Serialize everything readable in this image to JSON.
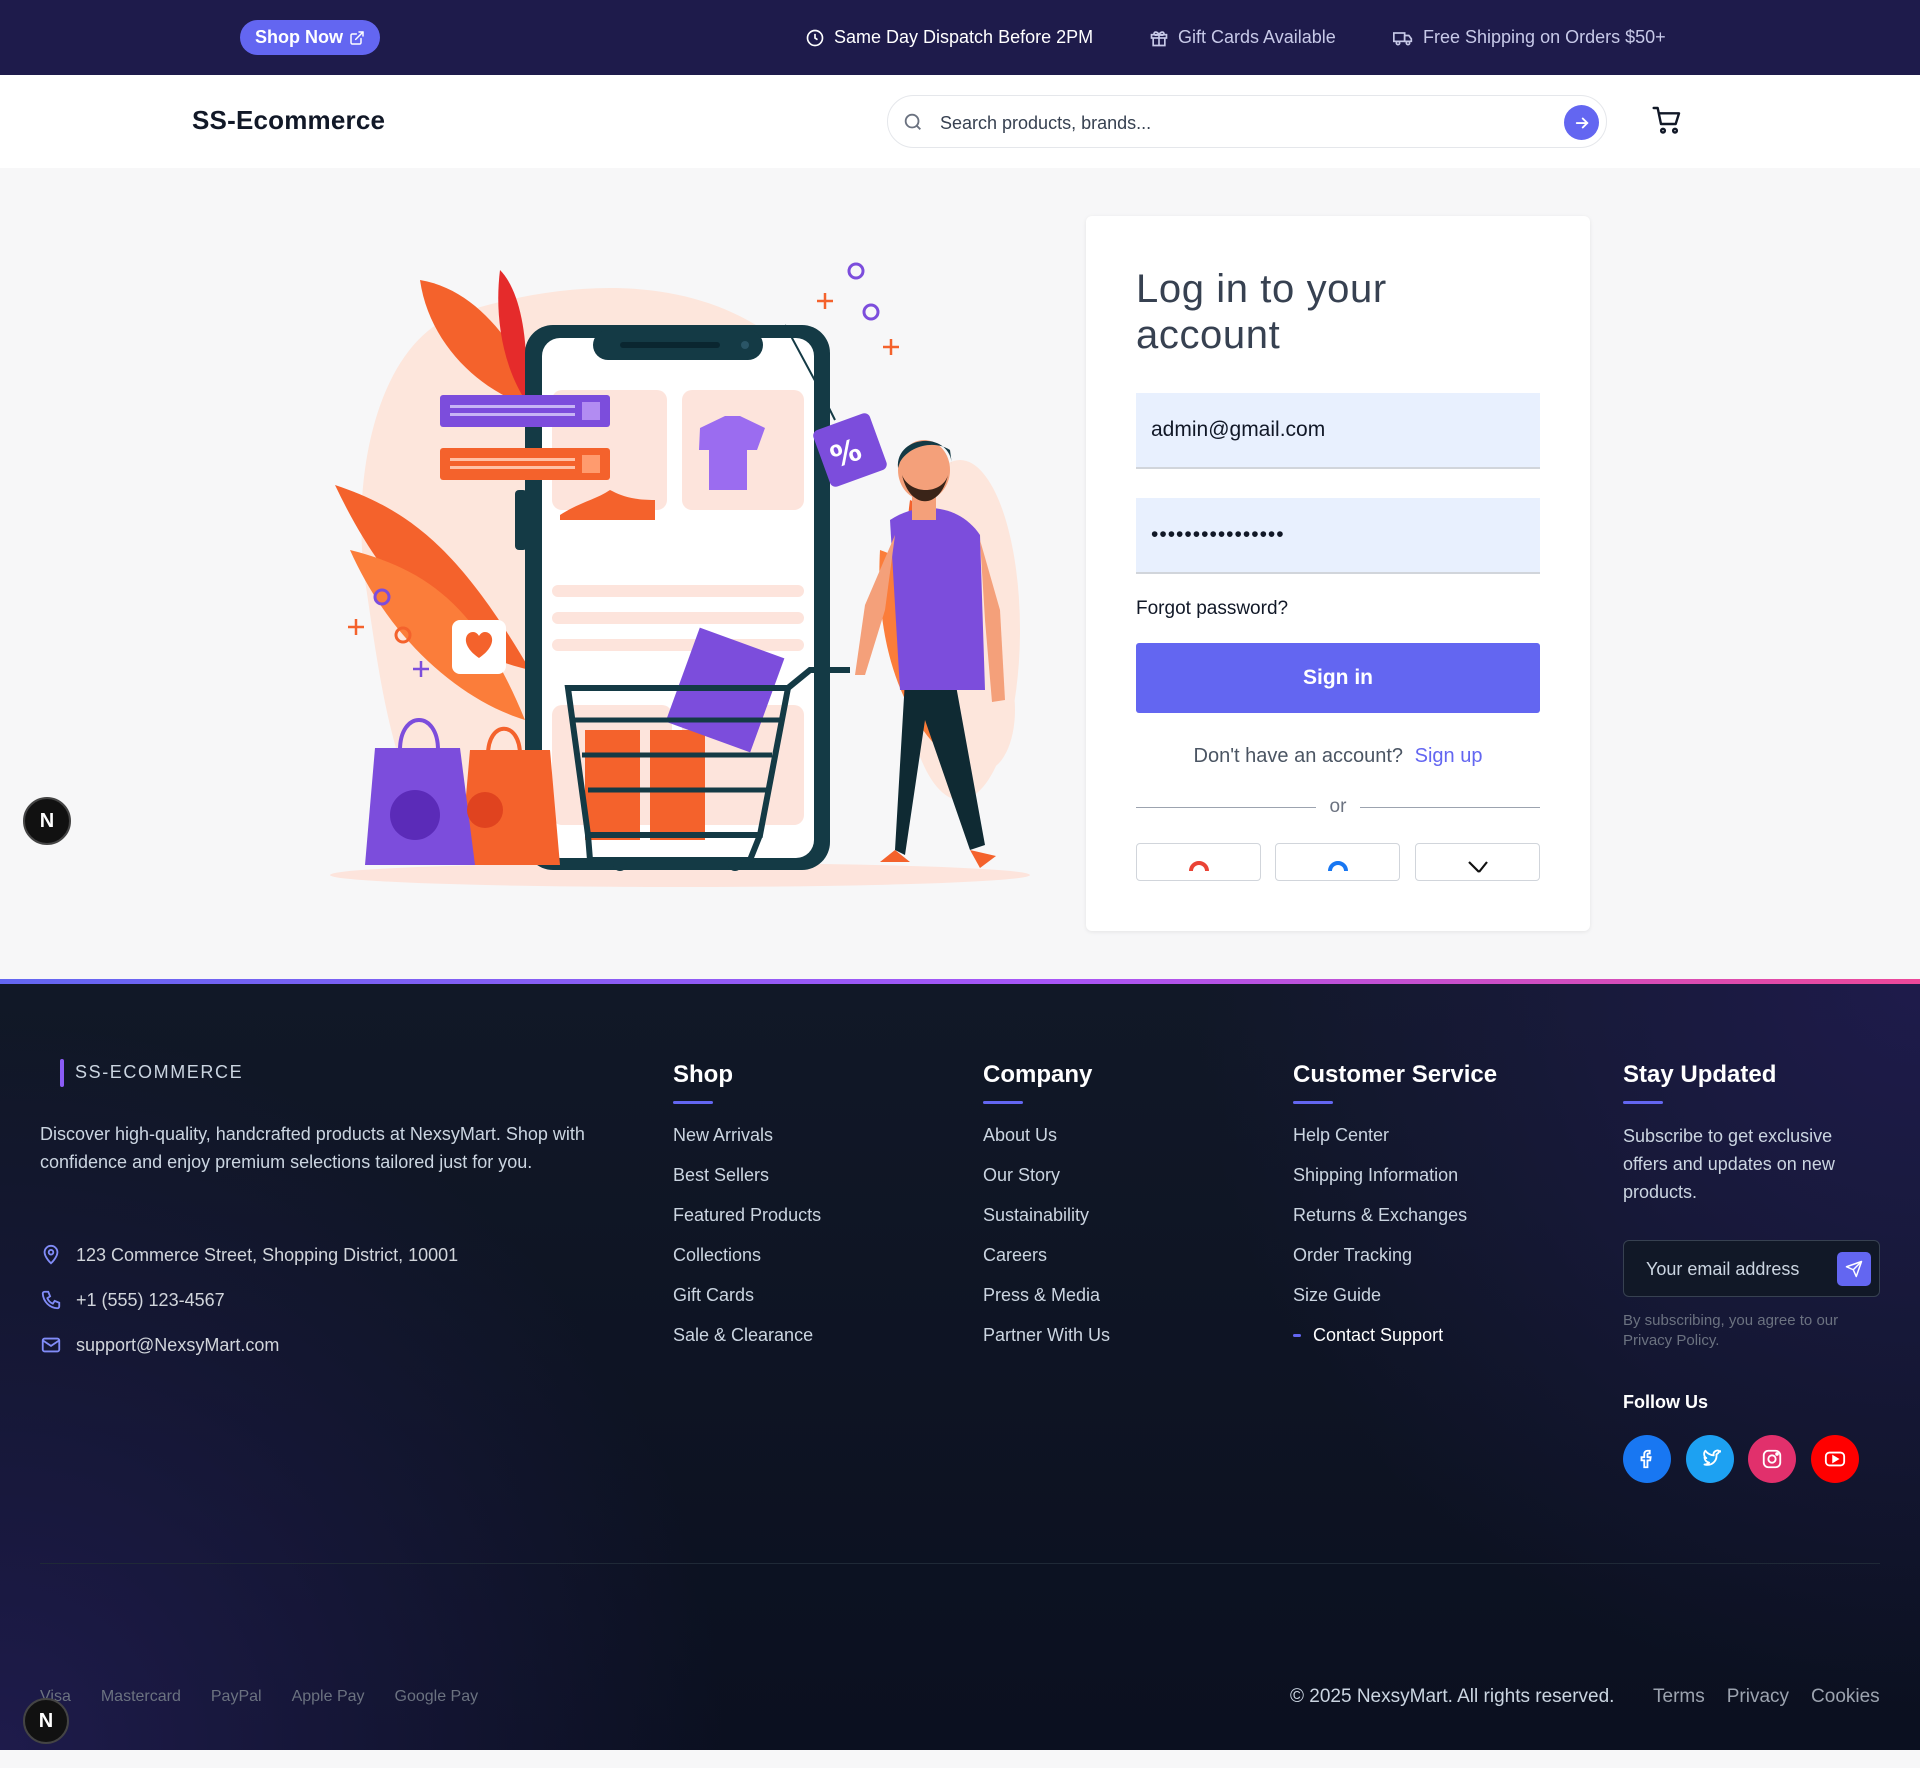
{
  "topbar": {
    "shop_now": "Shop Now",
    "info": [
      "Same Day Dispatch Before 2PM",
      "Gift Cards Available",
      "Free Shipping on Orders $50+"
    ]
  },
  "header": {
    "logo": "SS-Ecommerce",
    "search_placeholder": "Search products, brands..."
  },
  "login": {
    "title": "Log in to your account",
    "email_value": "admin@gmail.com",
    "password_value": "••••••••••••••••",
    "forgot": "Forgot password?",
    "signin": "Sign in",
    "no_account": "Don't have an account?",
    "signup": "Sign up",
    "or": "or"
  },
  "badge_letter": "N",
  "footer": {
    "brand": "SS-ECOMMERCE",
    "description": "Discover high-quality, handcrafted products at NexsyMart. Shop with confidence and enjoy premium selections tailored just for you.",
    "contact": {
      "address": "123 Commerce Street, Shopping District, 10001",
      "phone": "+1 (555) 123-4567",
      "email": "support@NexsyMart.com"
    },
    "shop": {
      "title": "Shop",
      "links": [
        "New Arrivals",
        "Best Sellers",
        "Featured Products",
        "Collections",
        "Gift Cards",
        "Sale & Clearance"
      ]
    },
    "company": {
      "title": "Company",
      "links": [
        "About Us",
        "Our Story",
        "Sustainability",
        "Careers",
        "Press & Media",
        "Partner With Us"
      ]
    },
    "service": {
      "title": "Customer Service",
      "links": [
        "Help Center",
        "Shipping Information",
        "Returns & Exchanges",
        "Order Tracking",
        "Size Guide",
        "Contact Support"
      ]
    },
    "stay": {
      "title": "Stay Updated",
      "description": "Subscribe to get exclusive offers and updates on new products.",
      "email_placeholder": "Your email address",
      "note": "By subscribing, you agree to our Privacy Policy.",
      "follow": "Follow Us"
    },
    "social": [
      {
        "icon": "facebook-icon",
        "color": "#1877f2"
      },
      {
        "icon": "twitter-icon",
        "color": "#1da1f2"
      },
      {
        "icon": "instagram-icon",
        "color": "#e1306c"
      },
      {
        "icon": "youtube-icon",
        "color": "#ff0000"
      }
    ],
    "payments": [
      "Visa",
      "Mastercard",
      "PayPal",
      "Apple Pay",
      "Google Pay"
    ],
    "copyright": "© 2025 NexsyMart. All rights reserved.",
    "legal": [
      "Terms",
      "Privacy",
      "Cookies"
    ]
  },
  "colors": {
    "primary": "#6366f1",
    "topbar_bg": "#1e1b4b",
    "footer_bg": "#111827",
    "illustration_orange": "#f4622c",
    "illustration_purple": "#7c4ddc"
  }
}
